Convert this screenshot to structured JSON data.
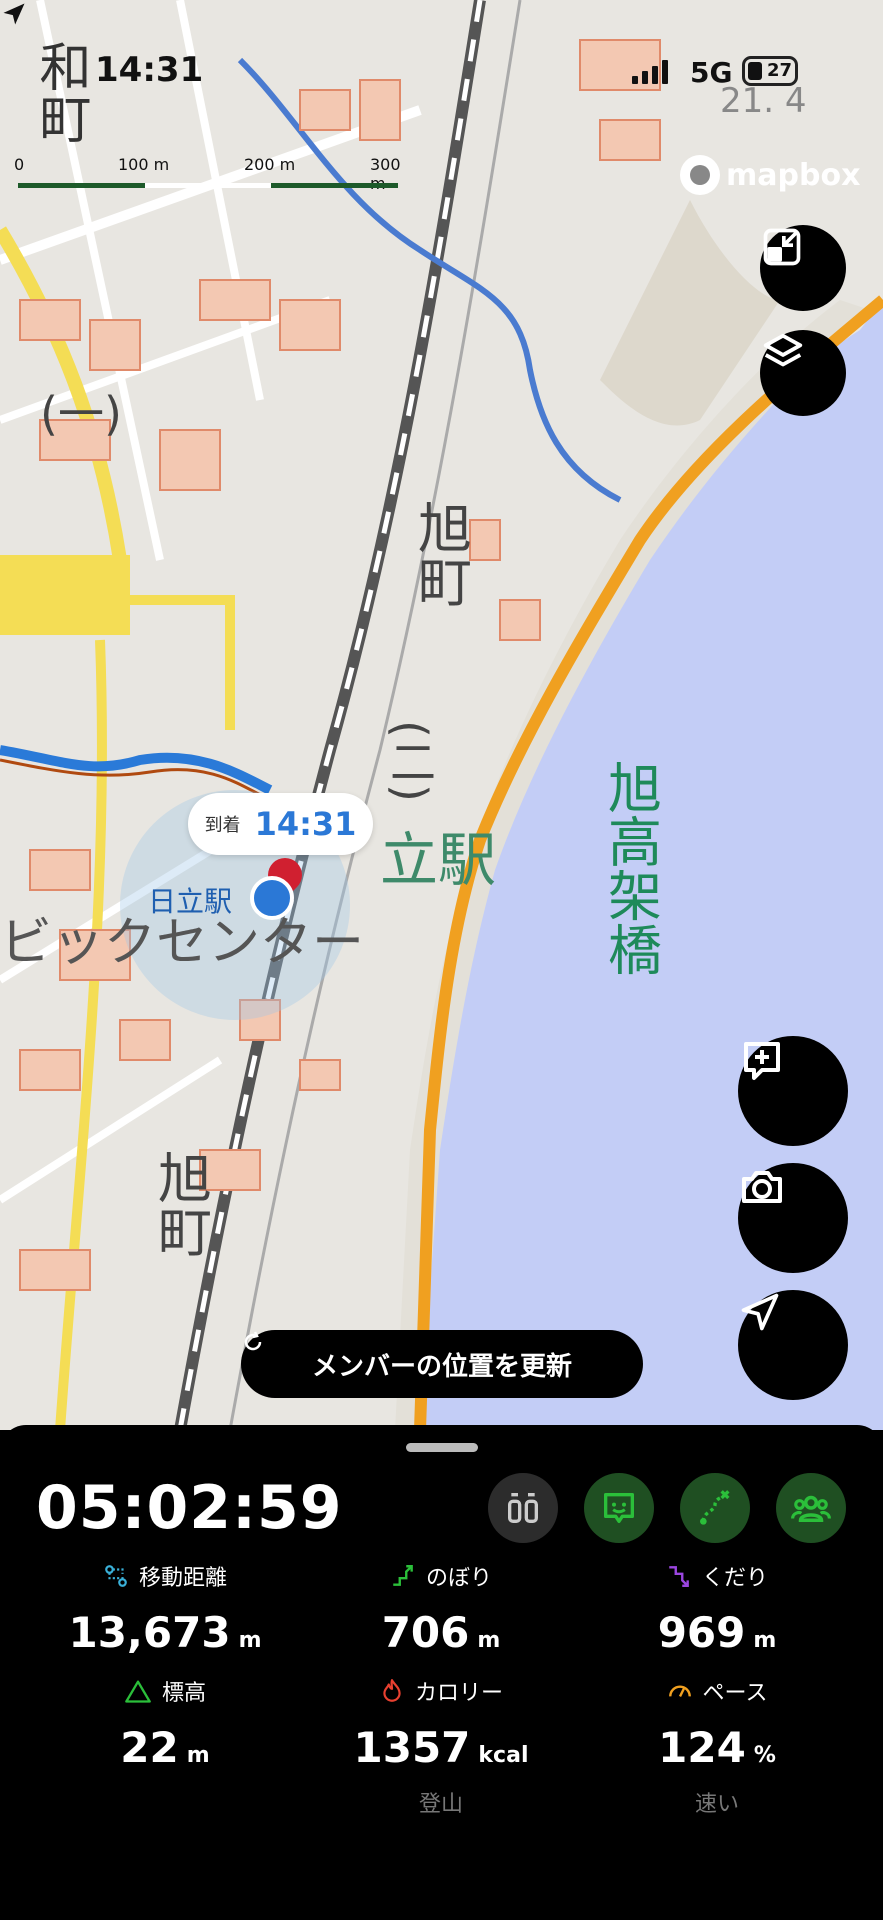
{
  "status_bar": {
    "time": "14:31",
    "network": "5G",
    "battery": "27"
  },
  "scale_bar": {
    "labels": [
      "0",
      "100 m",
      "200 m",
      "300 m"
    ]
  },
  "attribution": "mapbox",
  "map": {
    "labels": {
      "town_top": "和町",
      "asahi_1": "旭町",
      "asahi_2": "旭町",
      "chome_1": "(一)",
      "chome_2": "(二)",
      "station_big": "立駅",
      "center": "ビックセンター",
      "bridge": "旭高架橋",
      "faded_number": "21. 4"
    },
    "arrival_bubble": {
      "label": "到着",
      "time": "14:31"
    },
    "station_label": "日立駅"
  },
  "buttons": {
    "update_members": "メンバーの位置を更新"
  },
  "icons": [
    "collapse-icon",
    "layers-icon",
    "add-comment-icon",
    "camera-icon",
    "navigation-arrow-icon",
    "refresh-icon",
    "log-icon",
    "face-icon",
    "route-icon",
    "group-icon"
  ],
  "panel": {
    "elapsed": "05:02:59",
    "stats": {
      "distance": {
        "label": "移動距離",
        "value": "13,673",
        "unit": "m"
      },
      "ascent": {
        "label": "のぼり",
        "value": "706",
        "unit": "m"
      },
      "descent": {
        "label": "くだり",
        "value": "969",
        "unit": "m"
      },
      "altitude": {
        "label": "標高",
        "value": "22",
        "unit": "m"
      },
      "calories": {
        "label": "カロリー",
        "value": "1357",
        "unit": "kcal",
        "sub": "登山"
      },
      "pace": {
        "label": "ペース",
        "value": "124",
        "unit": "%",
        "sub": "速い"
      }
    }
  },
  "colors": {
    "accent_green": "#2bbf3a",
    "accent_blue": "#2b78d6",
    "road_orange": "#f0a020",
    "sea": "#c3cdf6"
  }
}
